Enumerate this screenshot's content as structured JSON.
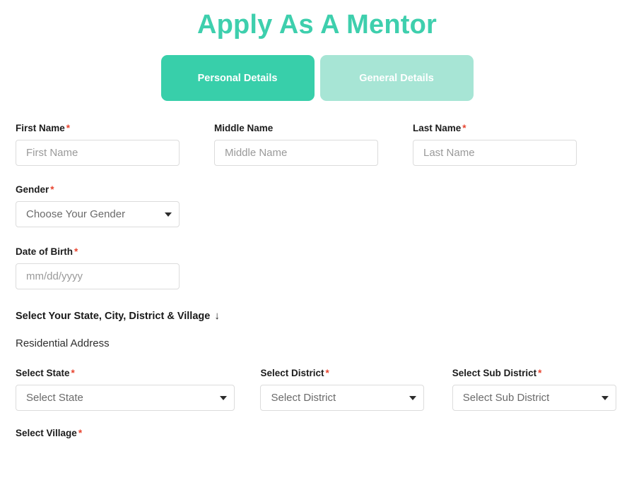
{
  "page": {
    "title": "Apply As A Mentor",
    "accent_color": "#3ecfad",
    "tab_active_color": "#38cfaa",
    "tab_inactive_color": "#a7e5d5",
    "required_marker_color": "#e8442f"
  },
  "tabs": [
    {
      "label": "Personal Details",
      "state": "active"
    },
    {
      "label": "General Details",
      "state": "inactive"
    }
  ],
  "form": {
    "name_row": [
      {
        "label": "First Name",
        "required_marker": "*",
        "placeholder": "First Name",
        "value": ""
      },
      {
        "label": "Middle Name",
        "required_marker": "",
        "placeholder": "Middle Name",
        "value": ""
      },
      {
        "label": "Last Name",
        "required_marker": "*",
        "placeholder": "Last Name",
        "value": ""
      }
    ],
    "gender": {
      "label": "Gender",
      "required_marker": "*",
      "selected": "Choose Your Gender"
    },
    "date_of_birth": {
      "label": "Date of Birth",
      "required_marker": "*",
      "placeholder": "mm/dd/yyyy",
      "value": ""
    },
    "location_section": {
      "heading": "Select Your State, City, District & Village",
      "heading_arrow": "↓",
      "sub_heading": "Residential Address",
      "selects": [
        {
          "label": "Select State",
          "required_marker": "*",
          "selected": "Select State"
        },
        {
          "label": "Select District",
          "required_marker": "*",
          "selected": "Select District"
        },
        {
          "label": "Select Sub District",
          "required_marker": "*",
          "selected": "Select Sub District"
        }
      ],
      "village": {
        "label": "Select Village",
        "required_marker": "*"
      }
    }
  }
}
